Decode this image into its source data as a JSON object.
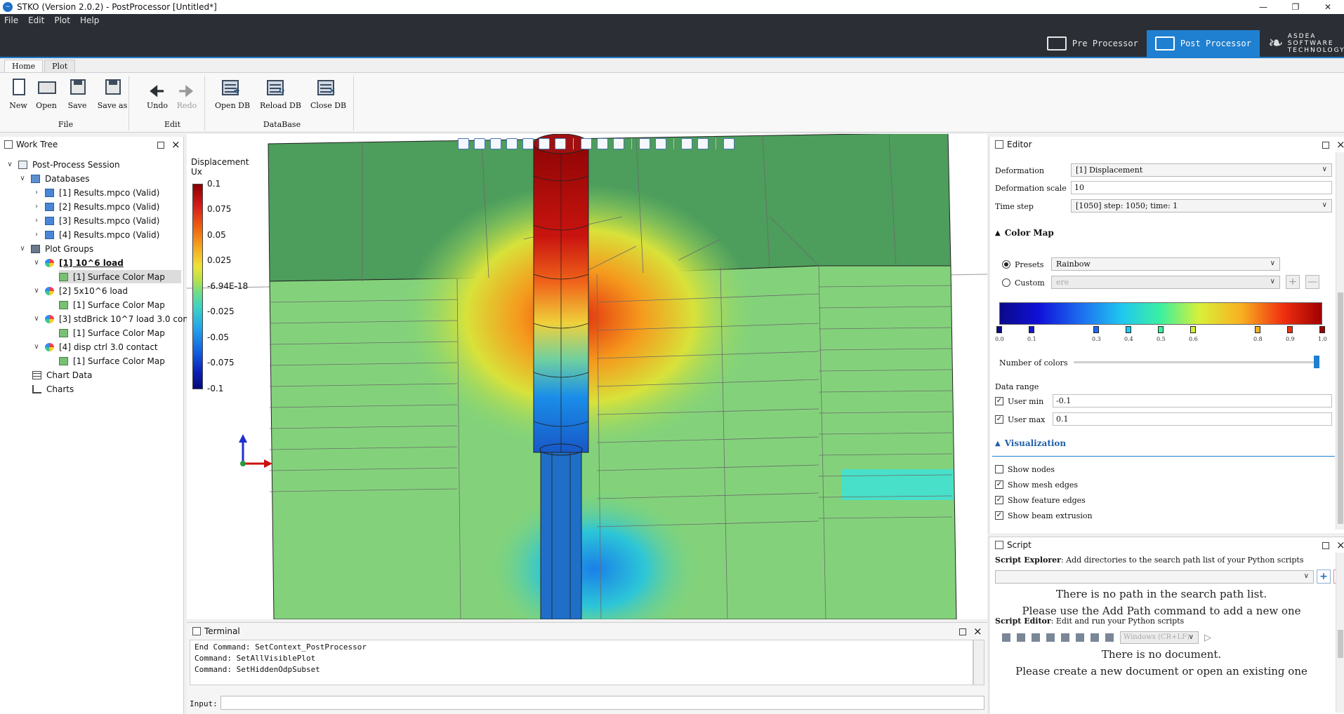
{
  "window": {
    "title": "STKO (Version 2.0.2) - PostProcessor [Untitled*]",
    "minimize": "—",
    "maximize": "❐",
    "close": "✕"
  },
  "menu": [
    "File",
    "Edit",
    "Plot",
    "Help"
  ],
  "switcher": {
    "pre": "Pre Processor",
    "post": "Post Processor",
    "brand_line1": "ASDEA",
    "brand_line2": "SOFTWARE",
    "brand_line3": "TECHNOLOGY"
  },
  "ribbon": {
    "tabs": [
      "Home",
      "Plot"
    ],
    "file": {
      "label": "File",
      "new": "New",
      "open": "Open",
      "save": "Save",
      "saveas": "Save as"
    },
    "edit": {
      "label": "Edit",
      "undo": "Undo",
      "redo": "Redo"
    },
    "database": {
      "label": "DataBase",
      "open": "Open DB",
      "reload": "Reload DB",
      "close": "Close DB"
    }
  },
  "worktree": {
    "title": "Work Tree",
    "session": "Post-Process Session",
    "databases": "Databases",
    "db_items": [
      "[1] Results.mpco (Valid)",
      "[2] Results.mpco (Valid)",
      "[3] Results.mpco (Valid)",
      "[4] Results.mpco (Valid)"
    ],
    "plot_groups": "Plot Groups",
    "groups": [
      {
        "name": "[1] 10^6 load",
        "child": "[1] Surface Color Map"
      },
      {
        "name": "[2] 5x10^6 load",
        "child": "[1] Surface Color Map"
      },
      {
        "name": "[3] stdBrick 10^7 load 3.0 con...",
        "child": "[1] Surface Color Map"
      },
      {
        "name": "[4] disp ctrl 3.0 contact",
        "child": "[1] Surface Color Map"
      }
    ],
    "chart_data": "Chart Data",
    "charts": "Charts"
  },
  "viewport": {
    "legend_title_1": "Displacement",
    "legend_title_2": "Ux",
    "legend_labels": [
      "0.1",
      "0.075",
      "0.05",
      "0.025",
      "-6.94E-18",
      "-0.025",
      "-0.05",
      "-0.075",
      "-0.1"
    ]
  },
  "terminal": {
    "title": "Terminal",
    "lines": [
      "End Command: SetContext_PostProcessor",
      "Command: SetAllVisiblePlot",
      "Command: SetHiddenOdpSubset"
    ],
    "input_label": "Input:"
  },
  "editor": {
    "title": "Editor",
    "deformation_label": "Deformation",
    "deformation_value": "[1] Displacement",
    "scale_label": "Deformation scale",
    "scale_value": "10",
    "timestep_label": "Time step",
    "timestep_value": "[1050] step: 1050; time: 1",
    "colormap_head": "Color Map",
    "presets_label": "Presets",
    "presets_value": "Rainbow",
    "custom_label": "Custom",
    "custom_value": "ere",
    "stops": [
      "0.0",
      "0.1",
      "0.3",
      "0.4",
      "0.5",
      "0.6",
      "0.8",
      "0.9",
      "1.0"
    ],
    "stop_colors": [
      "#0a0a8a",
      "#1418c8",
      "#1d6cf0",
      "#20c8f0",
      "#3cf0a0",
      "#d8f038",
      "#f8b020",
      "#f03010",
      "#a00000"
    ],
    "num_colors_label": "Number of colors",
    "data_range_label": "Data range",
    "user_min_label": "User min",
    "user_min_value": "-0.1",
    "user_max_label": "User max",
    "user_max_value": "0.1",
    "vis_head": "Visualization",
    "checks": [
      {
        "label": "Show nodes",
        "checked": false
      },
      {
        "label": "Show mesh edges",
        "checked": true
      },
      {
        "label": "Show feature edges",
        "checked": true
      },
      {
        "label": "Show beam extrusion",
        "checked": true
      }
    ]
  },
  "script": {
    "title": "Script",
    "explorer_bold": "Script Explorer",
    "explorer_desc": ": Add directories to the search path list of your Python scripts",
    "no_path_1": "There is no path in the search path list.",
    "no_path_2": "Please use the Add Path command to add a new one",
    "editor_bold": "Script Editor",
    "editor_desc": ": Edit and run your Python scripts",
    "line_ending": "Windows (CR+LF)",
    "no_doc_1": "There is no document.",
    "no_doc_2": "Please create a new document or open an existing one"
  },
  "colors": {
    "accent": "#1f7fd0",
    "dark_band": "#2b2f35"
  }
}
